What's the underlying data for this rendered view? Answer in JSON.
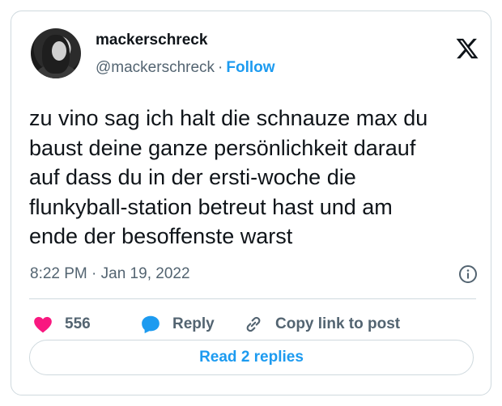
{
  "author": {
    "display_name": "mackerschreck",
    "handle": "@mackerschreck",
    "separator": "·",
    "follow_label": "Follow"
  },
  "tweet": {
    "text": "zu vino sag ich halt die schnauze max du\nbaust deine ganze persönlichkeit darauf\nauf dass du in der ersti-woche die\nflunkyball-station betreut hast und am\nende der besoffenste warst",
    "timestamp": "8:22 PM · Jan 19, 2022"
  },
  "actions": {
    "like_count": "556",
    "reply_label": "Reply",
    "copy_label": "Copy link to post"
  },
  "read_replies_label": "Read 2 replies",
  "colors": {
    "accent": "#1d9bf0",
    "heart": "#f91880",
    "text": "#0f1419",
    "muted": "#536471",
    "border": "#cfd9de"
  },
  "icons": [
    "x-logo-icon",
    "info-icon",
    "heart-icon",
    "reply-bubble-icon",
    "link-icon"
  ]
}
